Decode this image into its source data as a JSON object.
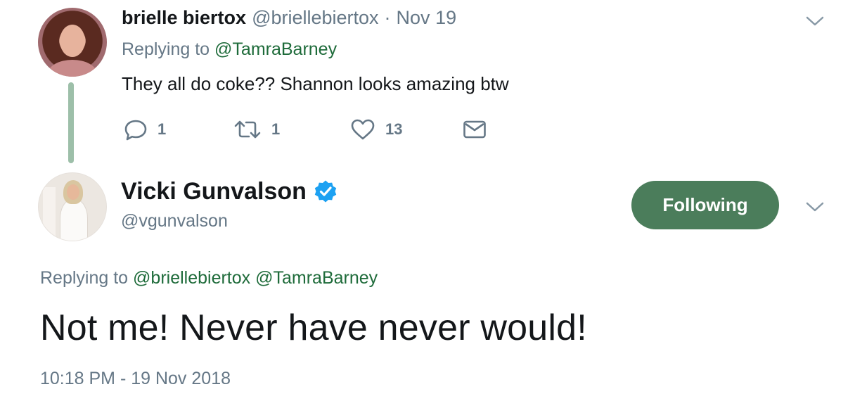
{
  "parent_tweet": {
    "display_name": "brielle biertox",
    "handle": "@briellebiertox",
    "separator": "·",
    "date": "Nov 19",
    "replying_prefix": "Replying to",
    "replying_to": "@TamraBarney",
    "text": "They all do coke?? Shannon looks amazing btw",
    "reply_count": "1",
    "retweet_count": "1",
    "like_count": "13"
  },
  "main_tweet": {
    "display_name": "Vicki Gunvalson",
    "handle": "@vgunvalson",
    "follow_label": "Following",
    "replying_prefix": "Replying to",
    "replying_to_1": "@briellebiertox",
    "replying_to_2": "@TamraBarney",
    "text": "Not me! Never have never would!",
    "timestamp": "10:18 PM - 19 Nov 2018"
  },
  "icons": {
    "reply": "reply-icon",
    "retweet": "retweet-icon",
    "like": "heart-icon",
    "dm": "envelope-icon",
    "verified": "verified-badge-icon",
    "menu": "chevron-down-icon"
  },
  "colors": {
    "accent_green": "#4b7d5b",
    "link_green": "#1e6b3a",
    "thread_line": "#9dbfa9",
    "verified_blue": "#1da1f2",
    "muted_text": "#657786"
  }
}
